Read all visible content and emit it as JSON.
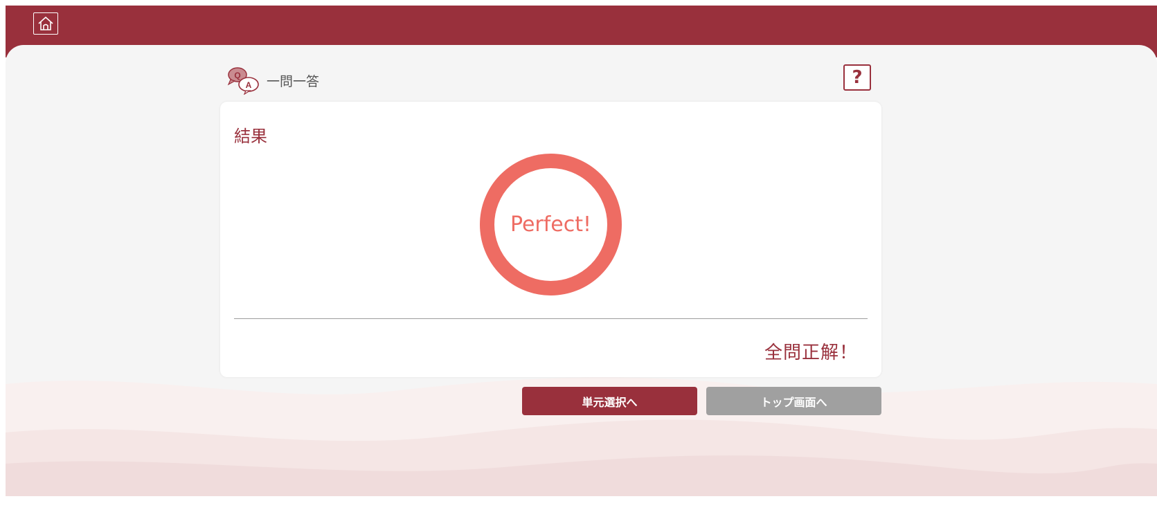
{
  "header": {
    "home_icon": "home-icon"
  },
  "mode": {
    "icon": "qa-bubbles-icon",
    "label": "一問一答"
  },
  "help": {
    "label": "?"
  },
  "result": {
    "title": "結果",
    "badge_text": "Perfect!",
    "message": "全問正解！"
  },
  "buttons": {
    "unit_select": "単元選択へ",
    "top_screen": "トップ画面へ"
  },
  "colors": {
    "brand": "#99303c",
    "ring": "#ee6c63",
    "disabled": "#a0a0a0"
  }
}
